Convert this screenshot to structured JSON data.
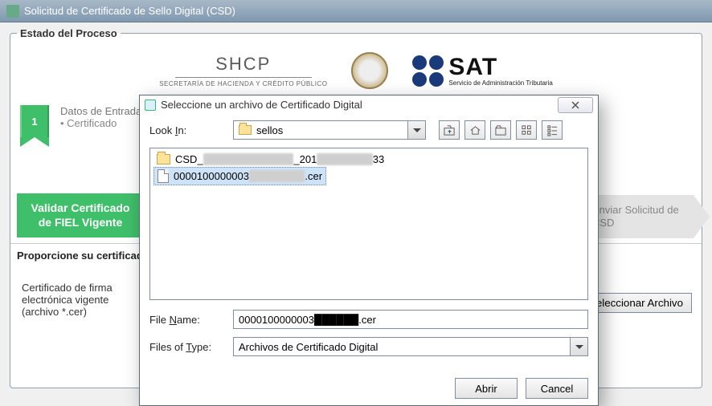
{
  "main_window": {
    "title": "Solicitud de Certificado de Sello Digital (CSD)"
  },
  "fieldset_legend": "Estado del Proceso",
  "logos": {
    "shcp_big": "SHCP",
    "shcp_small": "SECRETARÍA DE HACIENDA Y CRÉDITO PÚBLICO",
    "sat_big": "SAT",
    "sat_small": "Servicio de Administración Tributaria"
  },
  "step1": {
    "num": "1",
    "line1": "Datos de Entrada",
    "line2": "Certificado"
  },
  "green_button": "Validar Certificado de FIEL Vigente",
  "arrow_step": "Enviar Solicitud de CSD",
  "proporcione": "Proporcione su certificado",
  "cert_label_l1": "Certificado de firma",
  "cert_label_l2": "electrónica vigente",
  "cert_label_l3": "(archivo *.cer)",
  "seleccionar_btn": "Seleccionar Archivo",
  "dialog": {
    "title": "Seleccione un archivo de Certificado Digital",
    "look_in_label": "Look In:",
    "look_in_value": "sellos",
    "folder_item_prefix": "CSD_",
    "folder_item_suffix": "_201",
    "folder_item_tail": "33",
    "file_item_prefix": "0000100000003",
    "file_item_ext": ".cer",
    "filename_label": "File Name:",
    "filename_value_prefix": "0000100000003",
    "filename_value_suffix": ".cer",
    "filetype_label": "Files of Type:",
    "filetype_value": "Archivos de Certificado Digital",
    "open_btn": "Abrir",
    "cancel_btn": "Cancel"
  }
}
